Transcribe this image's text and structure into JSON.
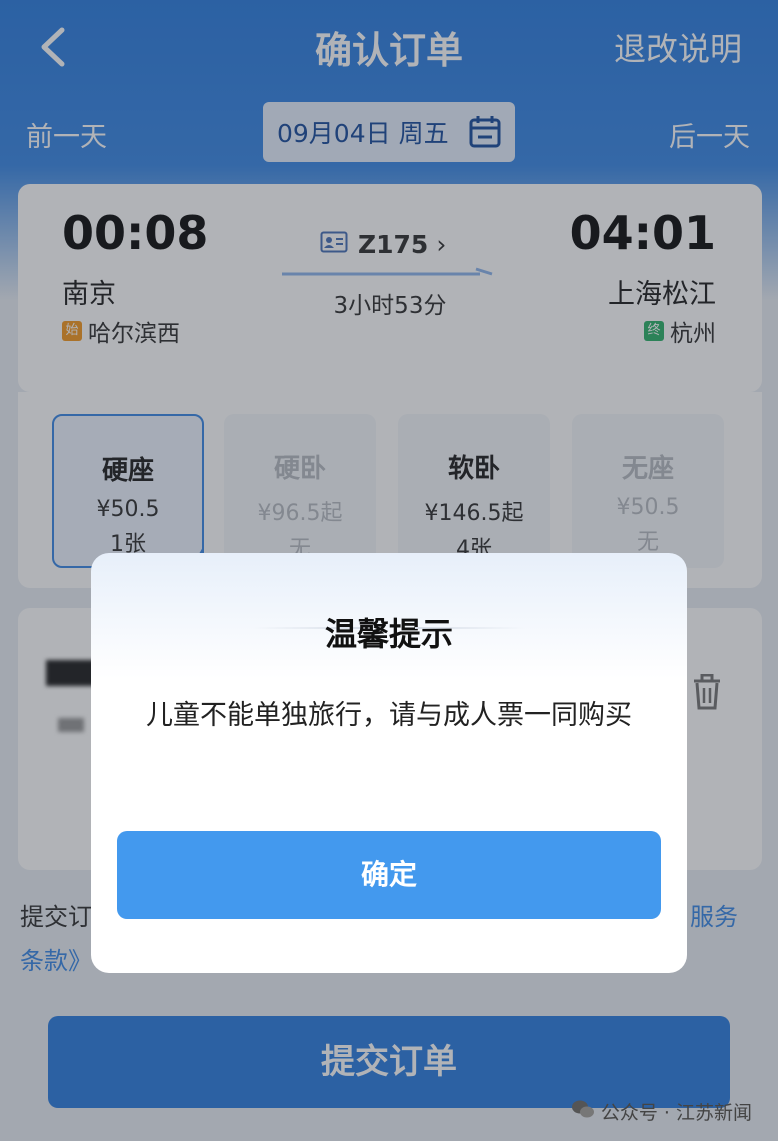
{
  "nav": {
    "title": "确认订单",
    "refund_label": "退改说明"
  },
  "date_bar": {
    "prev_label": "前一天",
    "date_text": "09月04日 周五",
    "next_label": "后一天"
  },
  "train": {
    "departure_time": "00:08",
    "departure_station": "南京",
    "origin_tag": "始",
    "origin_station": "哈尔滨西",
    "train_number": "Z175",
    "chevron": "›",
    "duration": "3小时53分",
    "arrival_time": "04:01",
    "arrival_station": "上海松江",
    "terminal_tag": "终",
    "terminal_station": "杭州"
  },
  "seats": [
    {
      "name": "硬座",
      "price": "¥50.5",
      "count": "1张",
      "selected": true,
      "available": true
    },
    {
      "name": "硬卧",
      "price": "¥96.5起",
      "count": "无",
      "selected": false,
      "available": false
    },
    {
      "name": "软卧",
      "price": "¥146.5起",
      "count": "4张",
      "selected": false,
      "available": true
    },
    {
      "name": "无座",
      "price": "¥50.5",
      "count": "无",
      "selected": false,
      "available": false
    }
  ],
  "terms": {
    "prefix": "提交订",
    "service_link": "服务",
    "suffix_link": "条款》"
  },
  "submit_label": "提交订单",
  "dialog": {
    "title": "温馨提示",
    "message": "儿童不能单独旅行，请与成人票一同购买",
    "confirm_label": "确定"
  },
  "watermark": "公众号 · 江苏新闻",
  "colors": {
    "brand_blue": "#2f7fe0",
    "confirm_blue": "#4399ee"
  }
}
